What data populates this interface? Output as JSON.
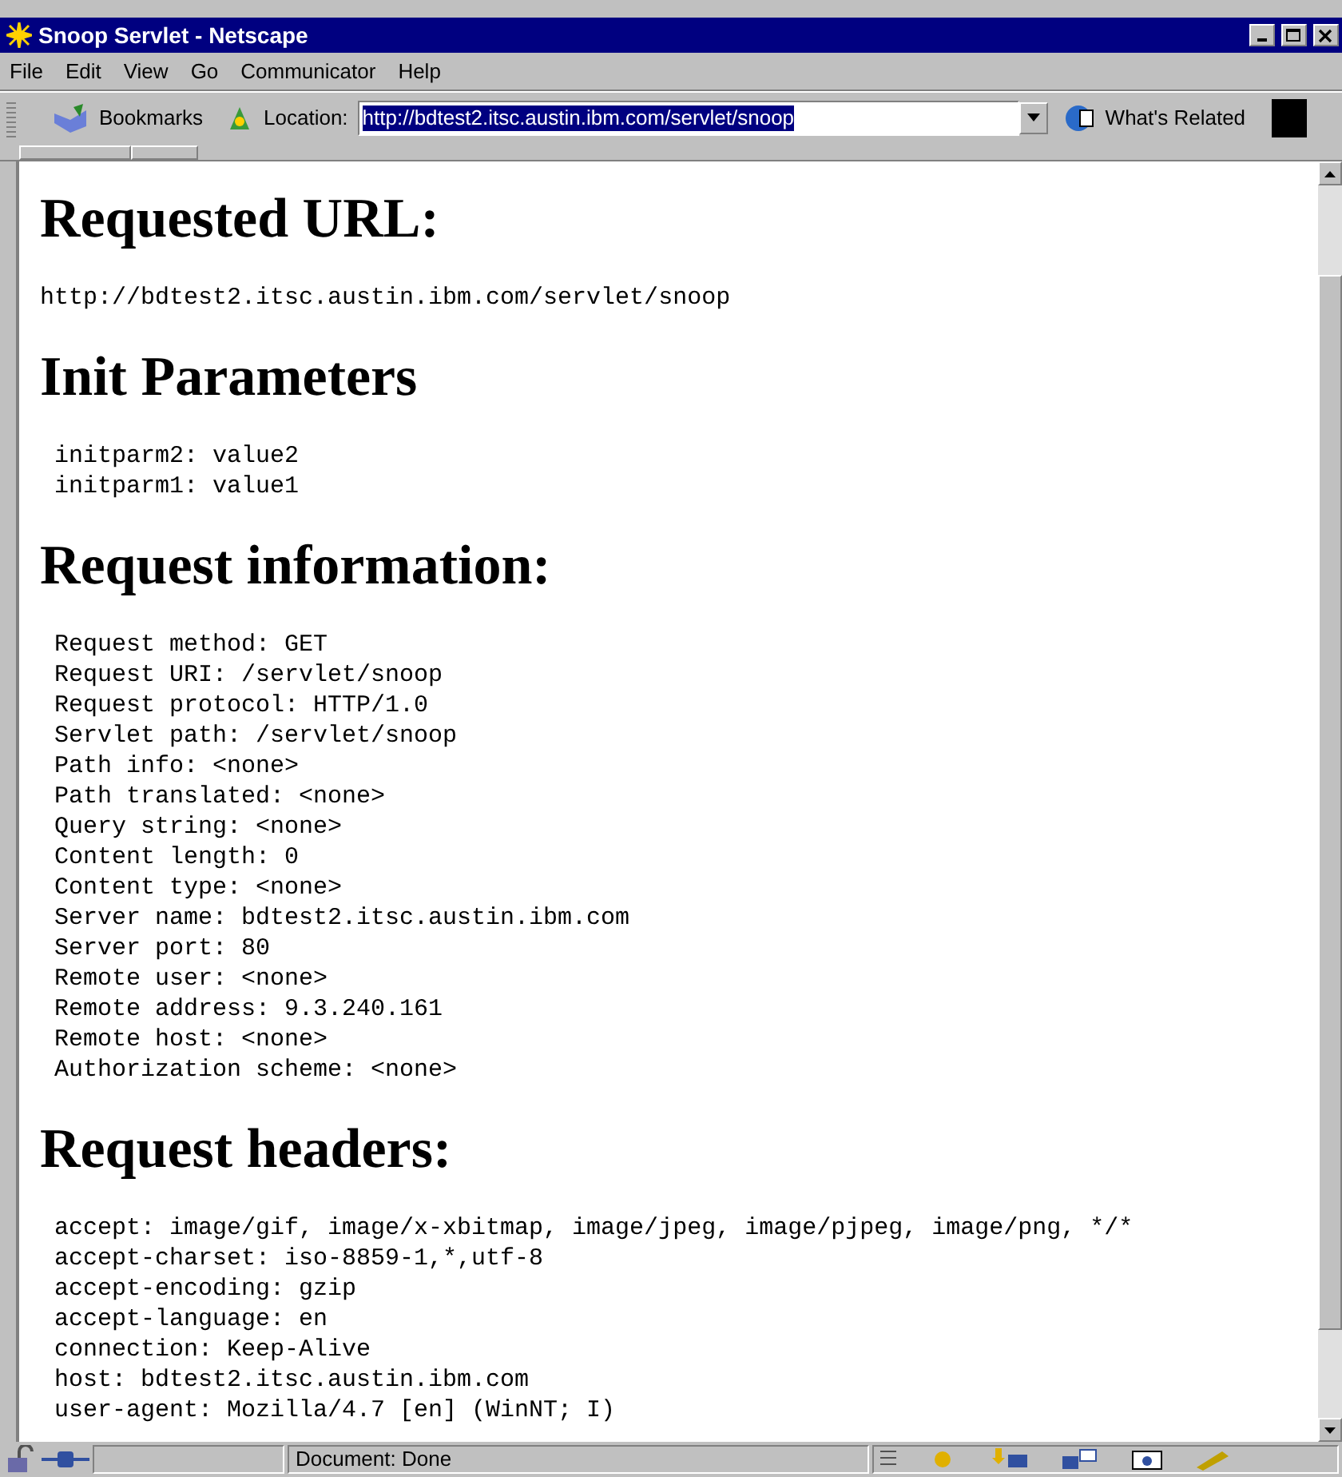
{
  "window": {
    "title": "Snoop Servlet - Netscape"
  },
  "menu": [
    "File",
    "Edit",
    "View",
    "Go",
    "Communicator",
    "Help"
  ],
  "toolbar": {
    "bookmarks": "Bookmarks",
    "location_label": "Location:",
    "location_value": "http://bdtest2.itsc.austin.ibm.com/servlet/snoop",
    "related": "What's Related"
  },
  "sections": [
    {
      "heading": "Requested URL:",
      "kind": "plain",
      "lines": [
        "http://bdtest2.itsc.austin.ibm.com/servlet/snoop"
      ]
    },
    {
      "heading": "Init Parameters",
      "kind": "list",
      "lines": [
        "initparm2: value2",
        "initparm1: value1"
      ]
    },
    {
      "heading": "Request information:",
      "kind": "list",
      "lines": [
        "Request method: GET",
        "Request URI: /servlet/snoop",
        "Request protocol: HTTP/1.0",
        "Servlet path: /servlet/snoop",
        "Path info: <none>",
        "Path translated: <none>",
        "Query string: <none>",
        "Content length: 0",
        "Content type: <none>",
        "Server name: bdtest2.itsc.austin.ibm.com",
        "Server port: 80",
        "Remote user: <none>",
        "Remote address: 9.3.240.161",
        "Remote host: <none>",
        "Authorization scheme: <none>"
      ]
    },
    {
      "heading": "Request headers:",
      "kind": "list",
      "lines": [
        "accept: image/gif, image/x-xbitmap, image/jpeg, image/pjpeg, image/png, */*",
        "accept-charset: iso-8859-1,*,utf-8",
        "accept-encoding: gzip",
        "accept-language: en",
        "connection: Keep-Alive",
        "host: bdtest2.itsc.austin.ibm.com",
        "user-agent: Mozilla/4.7 [en] (WinNT; I)"
      ]
    }
  ],
  "status_bar": {
    "text": "Document: Done"
  }
}
